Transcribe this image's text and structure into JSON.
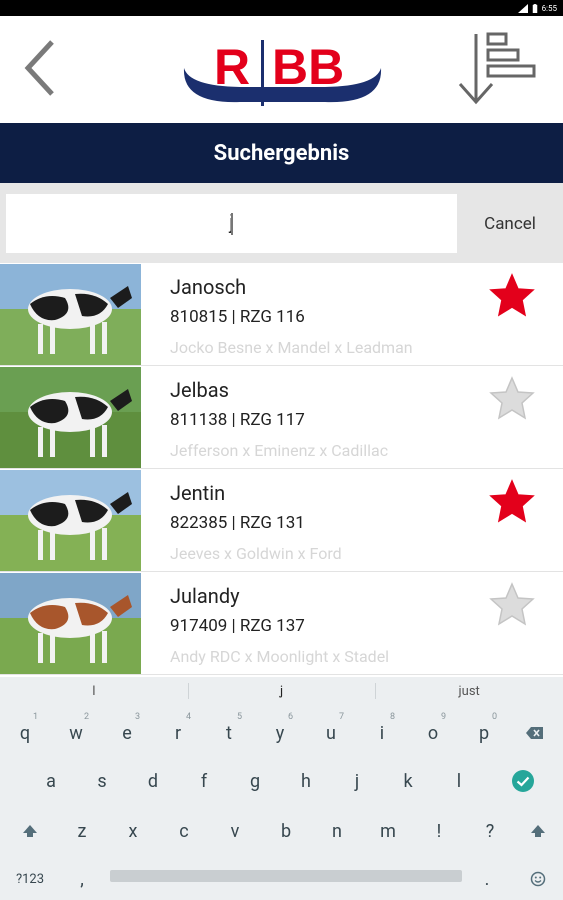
{
  "status": {
    "time": "6:55"
  },
  "header": {
    "logo_text": "RBB",
    "title": "Suchergebnis",
    "icons": {
      "back": "back-chevron-icon",
      "sort": "sort-descending-icon"
    }
  },
  "search": {
    "value": "j",
    "cancel_label": "Cancel"
  },
  "results": [
    {
      "name": "Janosch",
      "meta": "810815 | RZG 116",
      "pedigree": "Jocko Besne x Mandel x Leadman",
      "favorite": true,
      "colors": {
        "sky": "#8cb4d8",
        "ground": "#7fae5a",
        "coat": "bw"
      }
    },
    {
      "name": "Jelbas",
      "meta": "811138 | RZG 117",
      "pedigree": "Jefferson x Eminenz x Cadillac",
      "favorite": false,
      "colors": {
        "sky": "#6a9f52",
        "ground": "#5f8f3e",
        "coat": "bw"
      }
    },
    {
      "name": "Jentin",
      "meta": "822385 | RZG 131",
      "pedigree": "Jeeves x Goldwin x Ford",
      "favorite": true,
      "colors": {
        "sky": "#9cc0e0",
        "ground": "#84b155",
        "coat": "bw"
      }
    },
    {
      "name": "Julandy",
      "meta": "917409 | RZG 137",
      "pedigree": "Andy RDC x Moonlight x Stadel",
      "favorite": false,
      "colors": {
        "sky": "#7fa6c8",
        "ground": "#7aa94f",
        "coat": "rw"
      }
    }
  ],
  "keyboard": {
    "suggestions": [
      "I",
      "j",
      "just"
    ],
    "row1": [
      [
        "q",
        "1"
      ],
      [
        "w",
        "2"
      ],
      [
        "e",
        "3"
      ],
      [
        "r",
        "4"
      ],
      [
        "t",
        "5"
      ],
      [
        "y",
        "6"
      ],
      [
        "u",
        "7"
      ],
      [
        "i",
        "8"
      ],
      [
        "o",
        "9"
      ],
      [
        "p",
        "0"
      ]
    ],
    "row2": [
      "a",
      "s",
      "d",
      "f",
      "g",
      "h",
      "j",
      "k",
      "l"
    ],
    "row3": [
      "z",
      "x",
      "c",
      "v",
      "b",
      "n",
      "m",
      "!",
      "?"
    ],
    "row4": {
      "symbols_label": "?123",
      "comma": ",",
      "period": ".",
      "emoji_icon": "emoji-icon"
    }
  },
  "colors": {
    "brand_red": "#e3001b",
    "brand_navy": "#1b2f6e",
    "title_bar": "#0d1e44",
    "fav_star": "#e3001b",
    "star_empty": "#dcdcdc"
  }
}
